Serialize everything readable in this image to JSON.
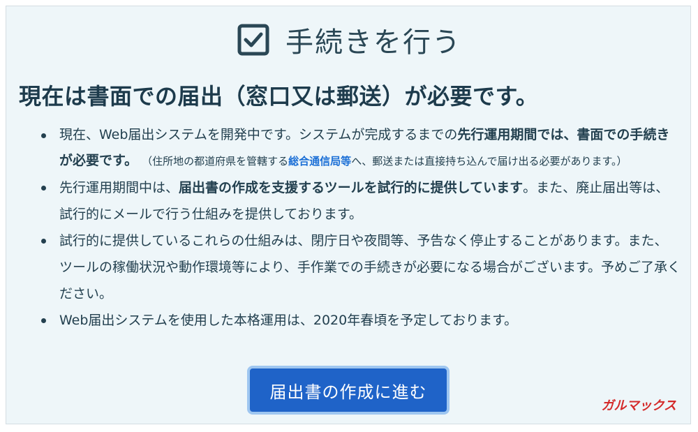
{
  "header": {
    "title": "手続きを行う",
    "icon": "checkbox-checked-icon"
  },
  "notice": {
    "heading": "現在は書面での届出（窓口又は郵送）が必要です。",
    "items": [
      {
        "part1": "現在、Web届出システムを開発中です。システムが完成するまでの",
        "bold": "先行運用期間では、書面での手続きが必要です。",
        "note_prefix": "（住所地の都道府県を管轄する",
        "note_link": "総合通信局等",
        "note_suffix": "へ、郵送または直接持ち込んで届け出る必要があります。）"
      },
      {
        "part1": "先行運用期間中は、",
        "bold": "届出書の作成を支援するツールを試行的に提供しています",
        "part2": "。また、廃止届出等は、試行的にメールで行う仕組みを提供しております。"
      },
      {
        "text": "試行的に提供しているこれらの仕組みは、閉庁日や夜間等、予告なく停止することがあります。また、ツールの稼働状況や動作環境等により、手作業での手続きが必要になる場合がございます。予めご了承ください。"
      },
      {
        "text": "Web届出システムを使用した本格運用は、2020年春頃を予定しております。"
      }
    ]
  },
  "cta": {
    "label": "届出書の作成に進む"
  },
  "watermark": {
    "text": "ガルマックス",
    "color": "#d42a2a"
  },
  "colors": {
    "panel": "#eef6f9",
    "text": "#1f3a4a",
    "link": "#1b6fd6",
    "button": "#1f63c8",
    "button_border": "#9ec6f0"
  }
}
